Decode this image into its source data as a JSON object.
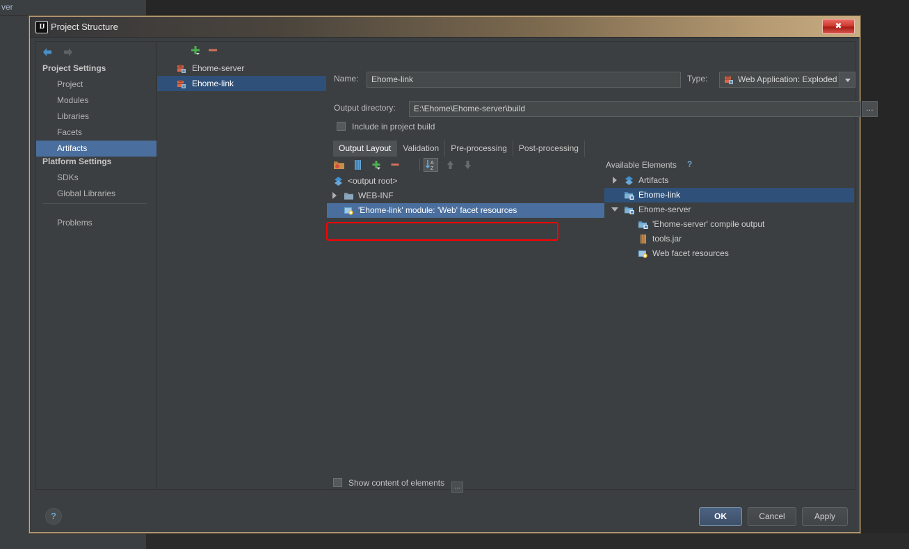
{
  "background": {
    "tab_text": "ver"
  },
  "dialog": {
    "title": "Project Structure",
    "logo_text": "IJ",
    "close_label": "✖"
  },
  "sidebar": {
    "nav": {
      "back_icon": "arrow-left-icon",
      "forward_icon": "arrow-right-icon"
    },
    "sections": [
      {
        "heading": "Project Settings",
        "items": [
          "Project",
          "Modules",
          "Libraries",
          "Facets",
          "Artifacts"
        ]
      },
      {
        "heading": "Platform Settings",
        "items": [
          "SDKs",
          "Global Libraries"
        ]
      }
    ],
    "extra_items": [
      "Problems"
    ],
    "selected": "Artifacts"
  },
  "artifacts_panel": {
    "add_label": "+",
    "remove_label": "−",
    "items": [
      {
        "label": "Ehome-server",
        "selected": false
      },
      {
        "label": "Ehome-link",
        "selected": true
      }
    ]
  },
  "form": {
    "name_label": "Name:",
    "name_value": "Ehome-link",
    "type_label": "Type:",
    "type_value": "Web Application: Exploded",
    "output_label": "Output directory:",
    "output_value": "E:\\Ehome\\Ehome-server\\build",
    "output_browse_label": "…",
    "include_label": "Include in project build",
    "include_checked": false
  },
  "tabs": [
    {
      "label": "Output Layout",
      "active": true
    },
    {
      "label": "Validation",
      "active": false
    },
    {
      "label": "Pre-processing",
      "active": false
    },
    {
      "label": "Post-processing",
      "active": false
    }
  ],
  "layout_toolbar": {
    "icons": [
      "create-directory-icon",
      "create-archive-icon",
      "add-element-icon",
      "remove-element-icon",
      "sort-icon",
      "move-up-icon",
      "move-down-icon"
    ]
  },
  "output_tree": {
    "rows": [
      {
        "label": "<output root>",
        "icon": "artifact-icon",
        "indent": 0,
        "twisty": "none",
        "selected": false
      },
      {
        "label": "WEB-INF",
        "icon": "folder-icon",
        "indent": 0,
        "twisty": "closed",
        "selected": false
      },
      {
        "label": "'Ehome-link' module: 'Web' facet resources",
        "icon": "facet-resources-icon",
        "indent": 1,
        "twisty": "none",
        "selected": true
      }
    ]
  },
  "available_elements": {
    "heading": "Available Elements",
    "help_label": "?",
    "rows": [
      {
        "label": "Artifacts",
        "icon": "artifact-icon",
        "indent": 0,
        "twisty": "closed",
        "selected": false
      },
      {
        "label": "Ehome-link",
        "icon": "module-icon",
        "indent": 0,
        "twisty": "none",
        "selected": true
      },
      {
        "label": "Ehome-server",
        "icon": "module-icon",
        "indent": 0,
        "twisty": "open",
        "selected": false
      },
      {
        "label": "'Ehome-server' compile output",
        "icon": "compile-output-icon",
        "indent": 1,
        "twisty": "none",
        "selected": false
      },
      {
        "label": "tools.jar",
        "icon": "jar-icon",
        "indent": 1,
        "twisty": "none",
        "selected": false
      },
      {
        "label": "Web facet resources",
        "icon": "facet-resources-icon",
        "indent": 1,
        "twisty": "none",
        "selected": false
      }
    ]
  },
  "show_content": {
    "label": "Show content of elements",
    "checked": false,
    "button_label": "…"
  },
  "footer": {
    "help_label": "?",
    "ok_label": "OK",
    "cancel_label": "Cancel",
    "apply_label": "Apply"
  },
  "colors": {
    "selection_blue": "#4a6f9e",
    "selection_dark_blue": "#2f5179",
    "annotation_red": "#ff0000",
    "dialog_bg": "#3c3f41",
    "link_blue": "#6aa3d0"
  }
}
